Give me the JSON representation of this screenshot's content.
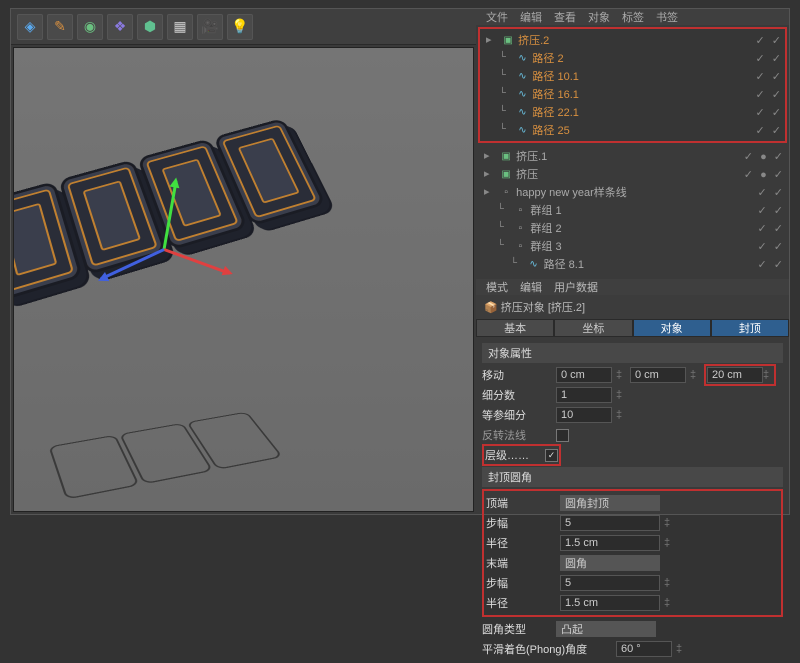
{
  "menubar": {
    "file": "文件",
    "edit": "编辑",
    "view": "查看",
    "object": "对象",
    "tag": "标签",
    "bookmark": "书签"
  },
  "hierarchy": {
    "highlighted": [
      {
        "icon": "ext",
        "label": "挤压.2",
        "indent": 0,
        "dots": "✓ ✓"
      },
      {
        "icon": "spl",
        "label": "路径 2",
        "indent": 1,
        "dots": "✓ ✓"
      },
      {
        "icon": "spl",
        "label": "路径 10.1",
        "indent": 1,
        "dots": "✓ ✓"
      },
      {
        "icon": "spl",
        "label": "路径 16.1",
        "indent": 1,
        "dots": "✓ ✓"
      },
      {
        "icon": "spl",
        "label": "路径 22.1",
        "indent": 1,
        "dots": "✓ ✓"
      },
      {
        "icon": "spl",
        "label": "路径 25",
        "indent": 1,
        "dots": "✓ ✓"
      }
    ],
    "rest": [
      {
        "icon": "ext",
        "label": "挤压.1",
        "indent": 0,
        "dots": "✓ ● ✓"
      },
      {
        "icon": "ext",
        "label": "挤压",
        "indent": 0,
        "dots": "✓ ● ✓"
      },
      {
        "icon": "null",
        "label": "happy new year样条线",
        "indent": 0,
        "dots": "✓ ✓"
      },
      {
        "icon": "null",
        "label": "群组 1",
        "indent": 1,
        "dots": "✓ ✓"
      },
      {
        "icon": "null",
        "label": "群组 2",
        "indent": 1,
        "dots": "✓ ✓"
      },
      {
        "icon": "null",
        "label": "群组 3",
        "indent": 1,
        "dots": "✓ ✓"
      },
      {
        "icon": "spl",
        "label": "路径 8.1",
        "indent": 2,
        "dots": "✓ ✓"
      }
    ]
  },
  "menubar2": {
    "mode": "模式",
    "edit": "编辑",
    "userdata": "用户数据"
  },
  "attr_header": {
    "icon": "📦",
    "title": "挤压对象 [挤压.2]"
  },
  "tabs": {
    "basic": "基本",
    "coord": "坐标",
    "object": "对象",
    "cap": "封顶"
  },
  "sections": {
    "obj_props": "对象属性",
    "cap_rounding": "封顶圆角"
  },
  "props": {
    "move_label": "移动",
    "move_x": "0 cm",
    "move_y": "0 cm",
    "move_z": "20 cm",
    "subdiv_label": "细分数",
    "subdiv": "1",
    "iso_label": "等参细分",
    "iso": "10",
    "flip_label": "反转法线",
    "flip": false,
    "hier_label": "层级……",
    "hier": true,
    "cap_label": "顶端",
    "cap_val": "圆角封顶",
    "step1_label": "步幅",
    "step1": "5",
    "rad1_label": "半径",
    "rad1": "1.5 cm",
    "end_label": "末端",
    "end_val": "圆角",
    "step2_label": "步幅",
    "step2": "5",
    "rad2_label": "半径",
    "rad2": "1.5 cm",
    "type_label": "圆角类型",
    "type_val": "凸起",
    "phong_label": "平滑着色(Phong)角度",
    "phong": "60 °"
  }
}
